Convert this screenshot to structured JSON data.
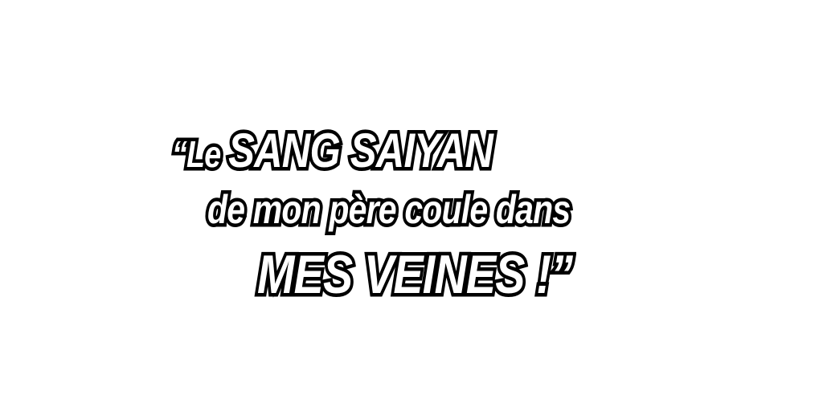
{
  "quote": {
    "line1_prefix": "“Le ",
    "line1_emphasis": "SANG SAIYAN",
    "line2": "de mon père coule dans",
    "line3": "MES VEINES !”"
  },
  "colors": {
    "text_fill": "#ffffff",
    "text_outline": "#000000",
    "background": "#ffffff"
  }
}
